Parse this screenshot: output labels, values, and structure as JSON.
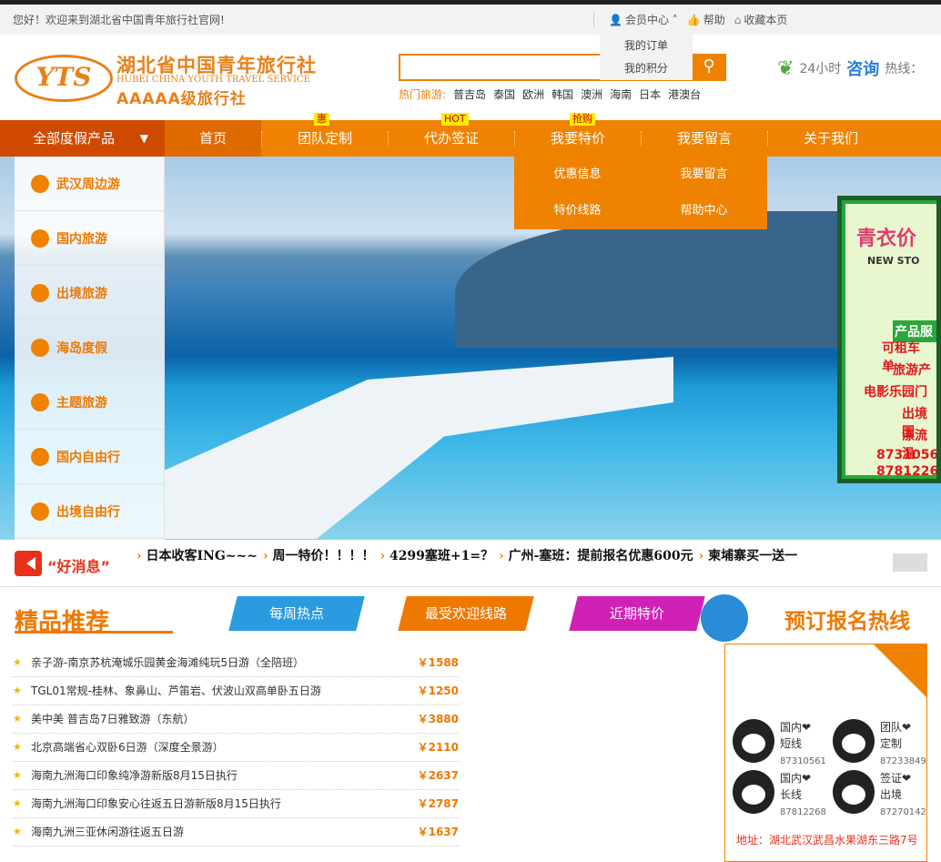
{
  "topbar": {
    "welcome": "您好！欢迎来到湖北省中国青年旅行社官网!",
    "member": "会员中心",
    "help": "帮助",
    "fav": "收藏本页",
    "dropdown": [
      "我的订单",
      "我的积分"
    ]
  },
  "logo": {
    "mark": "YTS",
    "cn": "湖北省中国青年旅行社",
    "en": "HUBEI CHINA YOUTH TRAVEL SERVICE",
    "level": "AAAAA级旅行社"
  },
  "search": {
    "placeholder": "",
    "hot_label": "热门旅游:",
    "hot": [
      "普吉岛",
      "泰国",
      "欧洲",
      "韩国",
      "澳洲",
      "海南",
      "日本",
      "港澳台"
    ]
  },
  "hotline": {
    "pre": "24小时",
    "bold": "咨询",
    "post": "热线："
  },
  "nav": {
    "all": "全部度假产品",
    "items": [
      {
        "label": "首页",
        "tag": ""
      },
      {
        "label": "团队定制",
        "tag": "惠"
      },
      {
        "label": "代办签证",
        "tag": "HOT"
      },
      {
        "label": "我要特价",
        "tag": "抢购"
      },
      {
        "label": "我要留言",
        "tag": ""
      },
      {
        "label": "关于我们",
        "tag": ""
      }
    ],
    "sub": [
      "优惠信息",
      "我要留言",
      "特价线路",
      "帮助中心"
    ]
  },
  "side": [
    "武汉周边游",
    "国内旅游",
    "出境旅游",
    "海岛度假",
    "主题旅游",
    "国内自由行",
    "出境自由行"
  ],
  "ad": {
    "title": "青衣价",
    "store": "NEW STO",
    "product": "产品服",
    "lines": [
      "可租车 单",
      "旅游产",
      "电影乐园门",
      "出境 国",
      "漂流 温",
      "8731056",
      "8781226"
    ]
  },
  "news": {
    "label": "“好消息”",
    "items": [
      "日本收客ING~~~",
      "周一特价！！！！",
      "4299塞班+1=？",
      "广州-塞班：提前报名优惠600元",
      "柬埔寨买一送一"
    ]
  },
  "rec": {
    "title": "精品推荐",
    "tabs": [
      "每周热点",
      "最受欢迎线路",
      "近期特价"
    ],
    "phone_title": "预订报名热线",
    "list": [
      {
        "name": "亲子游-南京苏杭淹城乐园黄金海滩纯玩5日游（全陪班）",
        "price": "￥1588"
      },
      {
        "name": "TGL01常规-桂林、象鼻山、芦笛岩、伏波山双高单卧五日游",
        "price": "￥1250"
      },
      {
        "name": "美中美 普吉岛7日雅致游（东航）",
        "price": "￥3880"
      },
      {
        "name": "北京高端省心双卧6日游（深度全景游）",
        "price": "￥2110"
      },
      {
        "name": "海南九洲海口印象纯净游新版8月15日执行",
        "price": "￥2637"
      },
      {
        "name": "海南九洲海口印象安心往返五日游新版8月15日执行",
        "price": "￥2787"
      },
      {
        "name": "海南九洲三亚休闲游往返五日游",
        "price": "￥1637"
      }
    ],
    "contacts": [
      {
        "a": "国内❤",
        "b": "短线",
        "n": "87310561"
      },
      {
        "a": "团队❤",
        "b": "定制",
        "n": "87233849"
      },
      {
        "a": "国内❤",
        "b": "长线",
        "n": "87812268"
      },
      {
        "a": "签证❤",
        "b": "出境",
        "n": "87270142"
      }
    ],
    "address": "地址：湖北武汉武昌水果湖东三路7号"
  }
}
